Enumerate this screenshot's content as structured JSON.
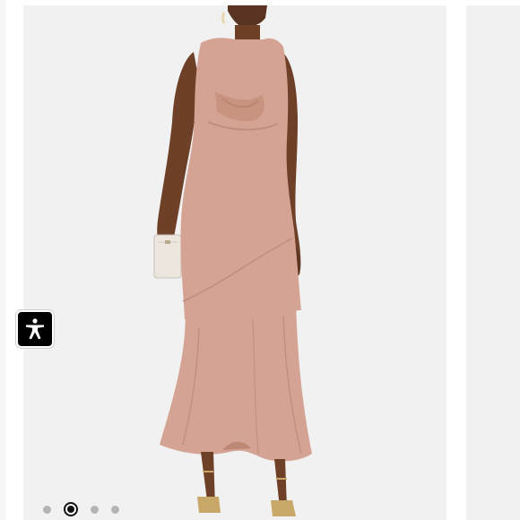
{
  "carousel": {
    "slide_count": 4,
    "active_index": 1
  },
  "product_image": {
    "alt": "",
    "icon": "model-in-blush-dress-image"
  },
  "accessibility": {
    "icon": "accessibility-person-icon",
    "color": "#000000"
  },
  "colors": {
    "dress": "#d4a393",
    "background": "#f1f1f1",
    "dot_inactive": "#b4b4b4",
    "dot_active": "#111111"
  }
}
